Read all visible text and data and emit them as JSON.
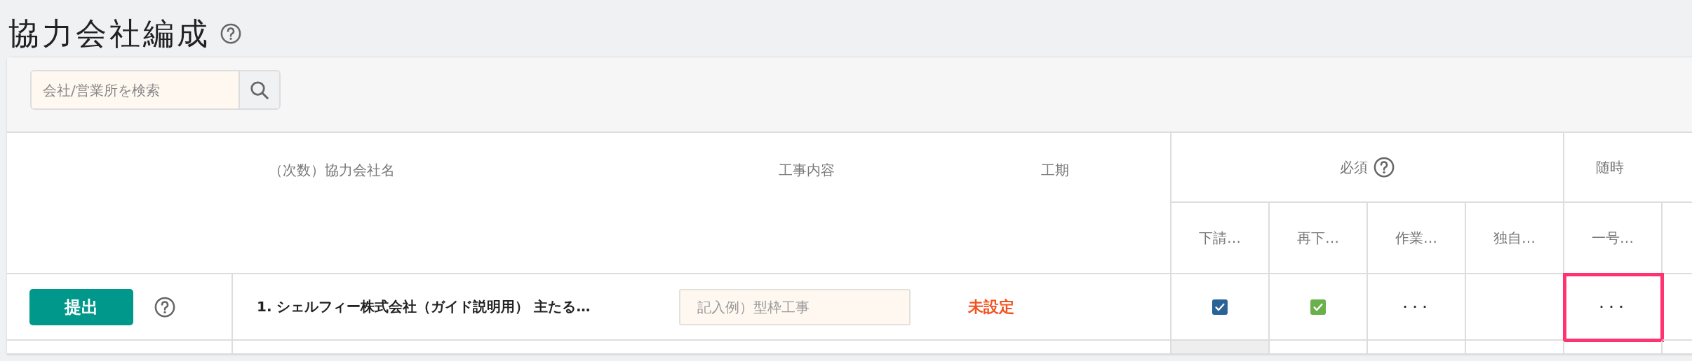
{
  "page": {
    "title": "協力会社編成"
  },
  "search": {
    "placeholder": "会社/営業所を検索"
  },
  "table": {
    "columns": {
      "name": "（次数）協力会社名",
      "work": "工事内容",
      "period": "工期",
      "groups": [
        {
          "label": "必須",
          "help": true,
          "docs": [
            "下請…",
            "再下…",
            "作業…",
            "独自…"
          ]
        },
        {
          "label": "随時",
          "help": false,
          "docs": [
            "一号…"
          ]
        }
      ]
    },
    "rows": [
      {
        "submit": "提出",
        "name": "1. シェルフィー株式会社（ガイド説明用） 主たる…",
        "work_placeholder": "記入例）型枠工事",
        "period": "未設定",
        "cells": [
          {
            "kind": "checkbox",
            "checked": true,
            "color": "#2a6496",
            "highlighted": false
          },
          {
            "kind": "checkbox",
            "checked": true,
            "color": "#6ab04c",
            "highlighted": false
          },
          {
            "kind": "more",
            "text": "･･･",
            "highlighted": false
          },
          {
            "kind": "empty",
            "highlighted": false
          },
          {
            "kind": "more",
            "text": "･･･",
            "highlighted": true
          }
        ]
      }
    ]
  }
}
